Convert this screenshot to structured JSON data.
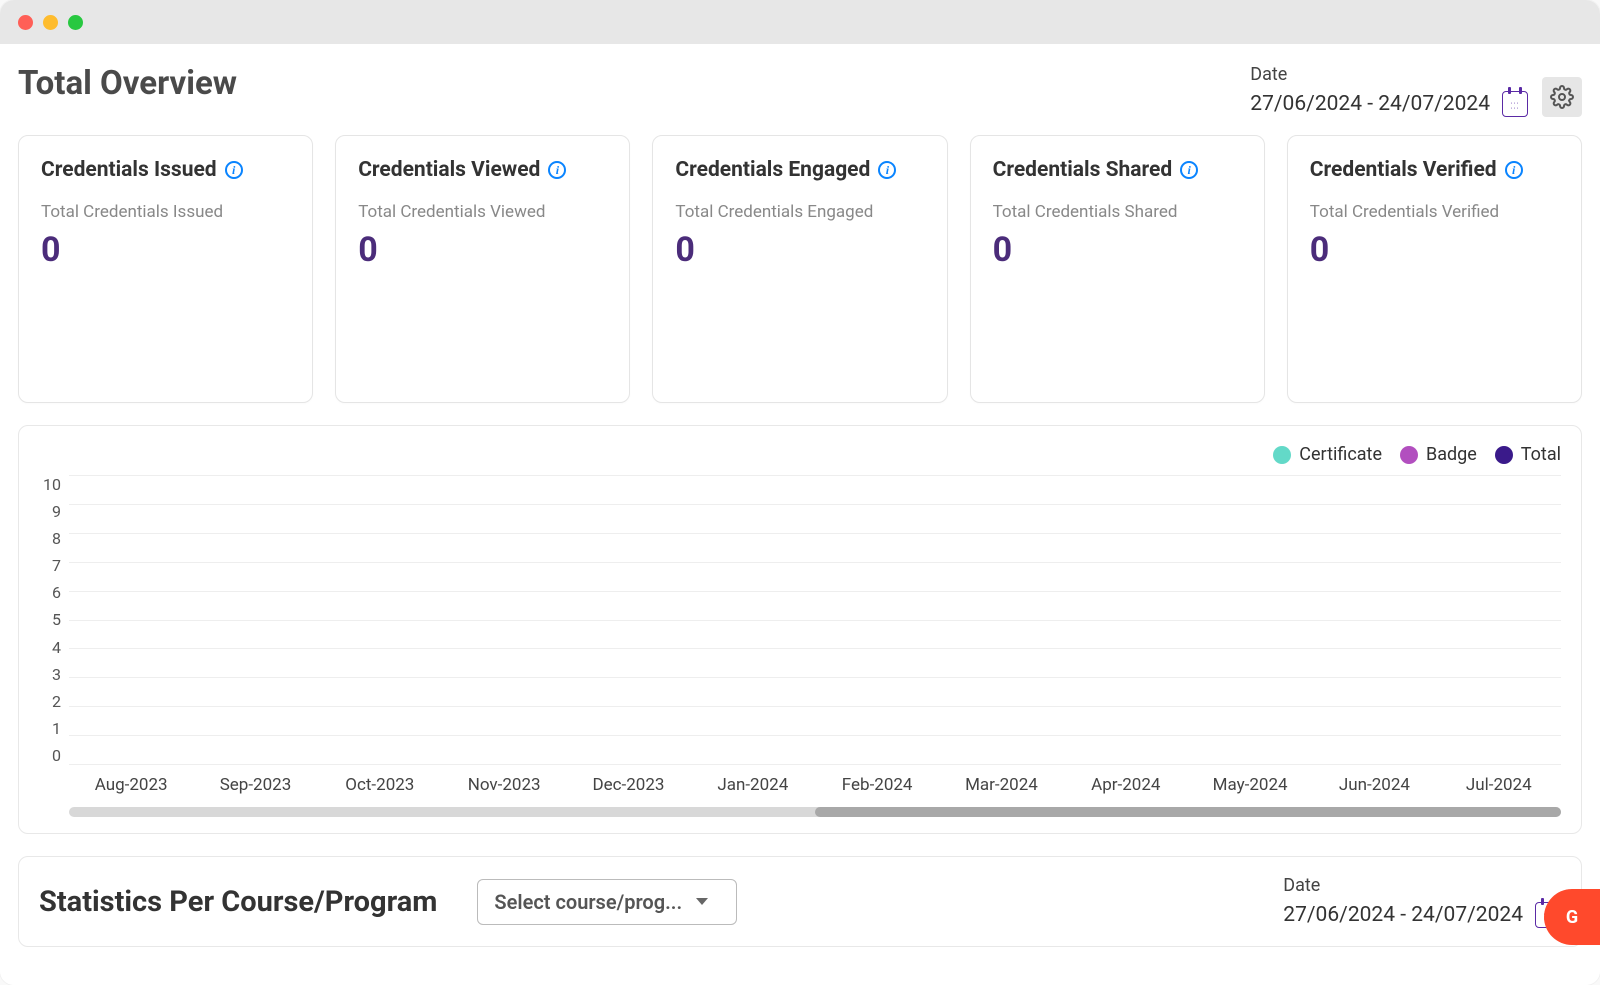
{
  "page_title": "Total Overview",
  "date": {
    "label": "Date",
    "range": "27/06/2024 - 24/07/2024"
  },
  "cards": [
    {
      "title": "Credentials Issued",
      "sub": "Total Credentials Issued",
      "value": "0"
    },
    {
      "title": "Credentials Viewed",
      "sub": "Total Credentials Viewed",
      "value": "0"
    },
    {
      "title": "Credentials Engaged",
      "sub": "Total Credentials Engaged",
      "value": "0"
    },
    {
      "title": "Credentials Shared",
      "sub": "Total Credentials Shared",
      "value": "0"
    },
    {
      "title": "Credentials Verified",
      "sub": "Total Credentials Verified",
      "value": "0"
    }
  ],
  "chart_data": {
    "type": "line",
    "title": "",
    "xlabel": "",
    "ylabel": "",
    "ylim": [
      0,
      10
    ],
    "yticks": [
      0,
      1,
      2,
      3,
      4,
      5,
      6,
      7,
      8,
      9,
      10
    ],
    "categories": [
      "Aug-2023",
      "Sep-2023",
      "Oct-2023",
      "Nov-2023",
      "Dec-2023",
      "Jan-2024",
      "Feb-2024",
      "Mar-2024",
      "Apr-2024",
      "May-2024",
      "Jun-2024",
      "Jul-2024"
    ],
    "series": [
      {
        "name": "Certificate",
        "color": "#63d9c8",
        "values": [
          0,
          0,
          0,
          0,
          0,
          0,
          0,
          0,
          0,
          0,
          0,
          0
        ]
      },
      {
        "name": "Badge",
        "color": "#b24fbf",
        "values": [
          0,
          0,
          0,
          0,
          0,
          0,
          0,
          0,
          0,
          0,
          0,
          0
        ]
      },
      {
        "name": "Total",
        "color": "#3a1a8a",
        "values": [
          0,
          0,
          0,
          0,
          0,
          0,
          0,
          0,
          0,
          0,
          0,
          0
        ]
      }
    ]
  },
  "stats_section": {
    "title": "Statistics Per Course/Program",
    "select_placeholder": "Select course/prog...",
    "date_label": "Date",
    "date_range": "27/06/2024 - 24/07/2024"
  },
  "g2_label": "G"
}
